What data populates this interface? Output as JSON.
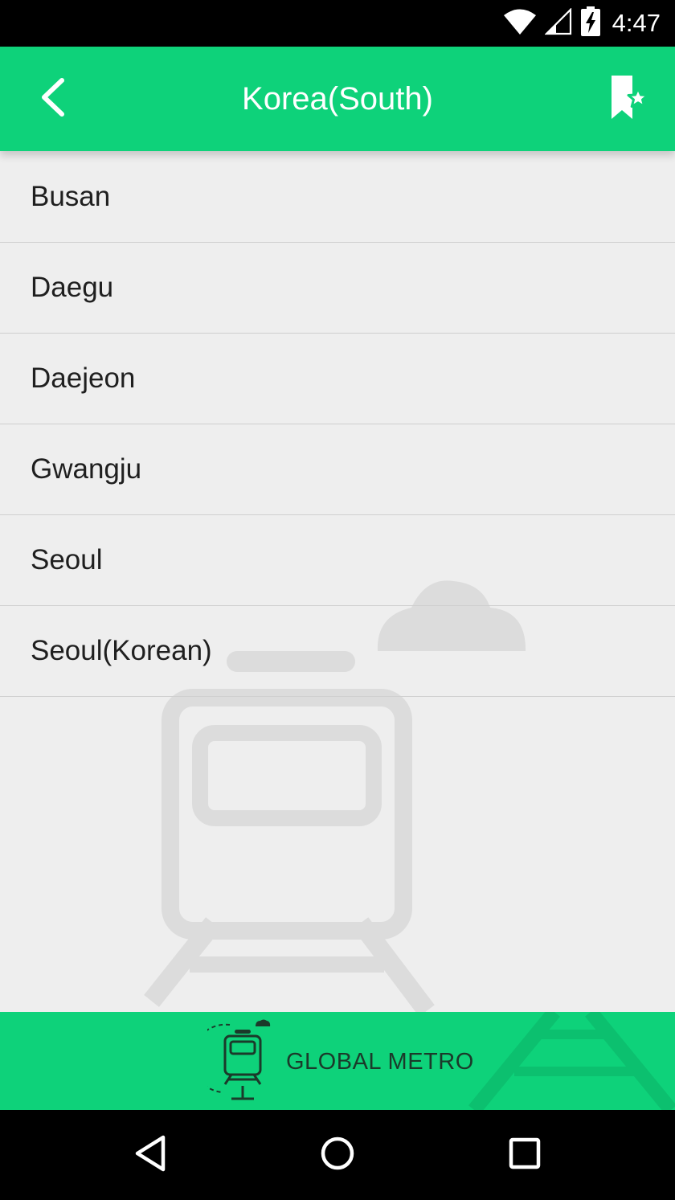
{
  "status_bar": {
    "time": "4:47",
    "icons": [
      "wifi-icon",
      "cell-signal-icon",
      "battery-charging-icon"
    ]
  },
  "app_bar": {
    "title": "Korea(South)",
    "back_icon": "chevron-left-icon",
    "bookmark_icon": "bookmark-star-icon",
    "color": "#0ed27a"
  },
  "cities": [
    {
      "name": "Busan"
    },
    {
      "name": "Daegu"
    },
    {
      "name": "Daejeon"
    },
    {
      "name": "Gwangju"
    },
    {
      "name": "Seoul"
    },
    {
      "name": "Seoul(Korean)"
    }
  ],
  "footer": {
    "brand_name": "GLOBAL METRO",
    "logo_icon": "train-icon"
  },
  "nav_bar": {
    "buttons": [
      "back-triangle-icon",
      "home-circle-icon",
      "recents-square-icon"
    ]
  }
}
